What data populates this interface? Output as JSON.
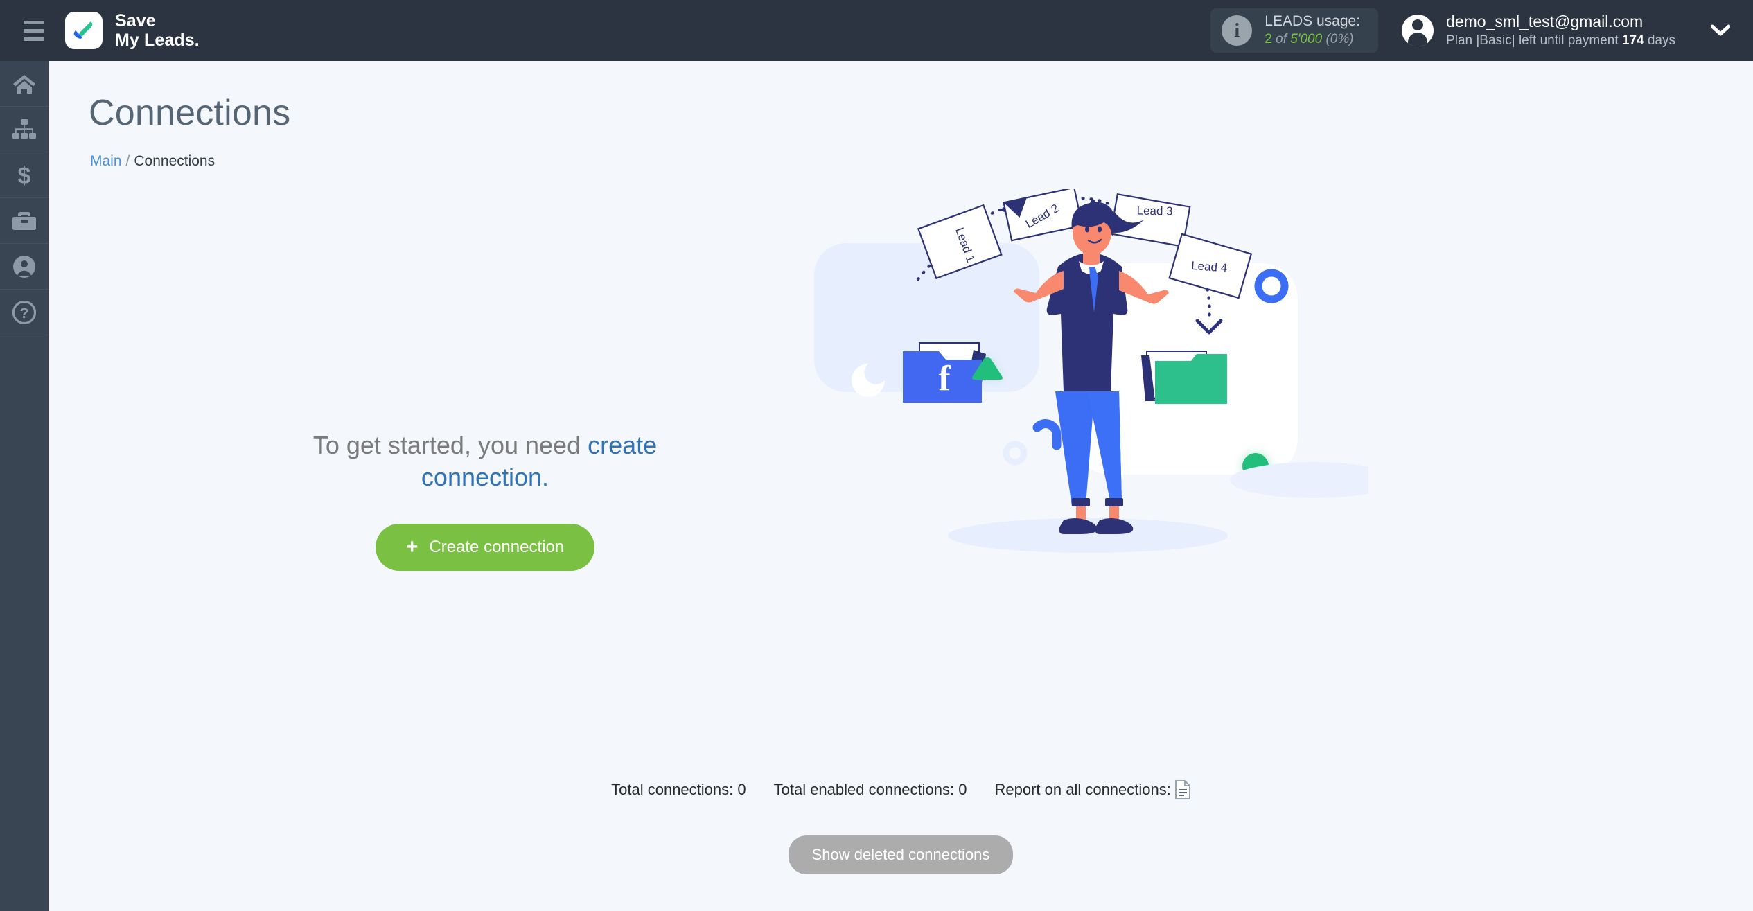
{
  "header": {
    "menu_icon": "hamburger-menu-icon",
    "brand": {
      "line1": "Save",
      "line2": "My Leads.",
      "logo_icon": "checkmark-logo-icon"
    },
    "leads_usage": {
      "info_icon": "info-icon",
      "title": "LEADS usage:",
      "used": "2",
      "of": " of ",
      "total": "5'000",
      "percent": "(0%)"
    },
    "account": {
      "avatar_icon": "user-avatar-icon",
      "email": "demo_sml_test@gmail.com",
      "plan_prefix": "Plan |Basic| left until payment ",
      "plan_days": "174",
      "plan_suffix": " days",
      "chevron_icon": "chevron-down-icon"
    }
  },
  "sidebar": {
    "items": [
      {
        "name": "home",
        "icon": "home-icon"
      },
      {
        "name": "connections",
        "icon": "sitemap-icon"
      },
      {
        "name": "payments",
        "icon": "dollar-icon"
      },
      {
        "name": "business",
        "icon": "briefcase-icon"
      },
      {
        "name": "profile",
        "icon": "user-circle-icon"
      },
      {
        "name": "help",
        "icon": "question-circle-icon"
      }
    ]
  },
  "page": {
    "title": "Connections",
    "breadcrumb": {
      "root": "Main",
      "separator": "/",
      "current": "Connections"
    }
  },
  "empty_state": {
    "text_plain": "To get started, you need ",
    "text_link": "create connection.",
    "button": {
      "label": "Create connection",
      "plus": "+",
      "color": "#7ac143"
    }
  },
  "footer_stats": {
    "total_connections": "Total connections: 0",
    "total_enabled": "Total enabled connections: 0",
    "report_label": "Report on all connections:",
    "report_icon": "document-report-icon",
    "show_deleted_button": "Show deleted connections"
  },
  "illustration": {
    "name": "leads-transfer-illustration",
    "leads": [
      "Lead 1",
      "Lead 2",
      "Lead 3",
      "Lead 4"
    ],
    "source_icon": "facebook-folder-icon",
    "target_icon": "green-folder-icon",
    "colors": {
      "navy": "#2d3277",
      "blue": "#3b6ef5",
      "facebook_blue": "#4267f0",
      "green": "#2dc08d",
      "skin": "#f8886e",
      "card_left": "#e6edfd",
      "card_right": "#ffffff"
    }
  },
  "theme": {
    "topbar_bg": "#2b3440",
    "sidebar_bg": "#3a4553",
    "page_bg": "#f4f7fb",
    "accent_green": "#7ac143",
    "link_blue": "#2f72b5",
    "title_gray": "#566573"
  }
}
